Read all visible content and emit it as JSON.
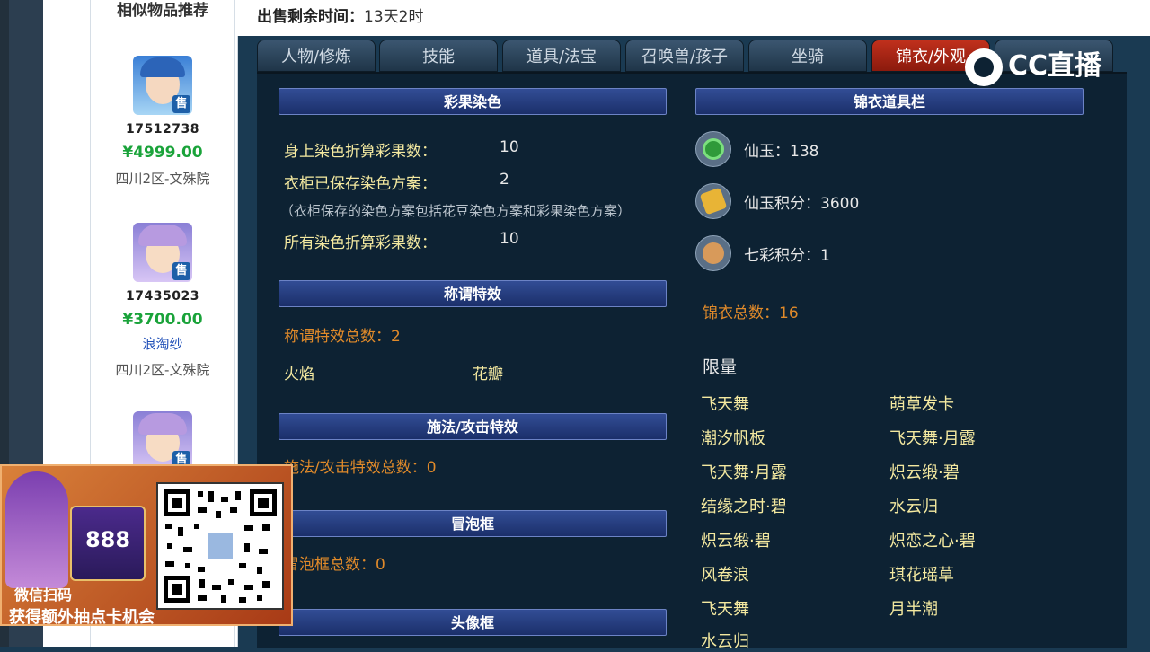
{
  "left_panel": {
    "title": "相似物品推荐",
    "items": [
      {
        "id": "17512738",
        "price": "¥4999.00",
        "extra": "",
        "server": "四川2区-文殊院",
        "sell": "售"
      },
      {
        "id": "17435023",
        "price": "¥3700.00",
        "extra": "浪淘纱",
        "server": "四川2区-文殊院",
        "sell": "售"
      },
      {
        "id": "",
        "price": "",
        "extra": "",
        "server": "",
        "sell": "售"
      }
    ]
  },
  "header": {
    "label": "出售剩余时间：",
    "value": "13天2时"
  },
  "tabs": [
    {
      "label": "人物/修炼",
      "active": false
    },
    {
      "label": "技能",
      "active": false
    },
    {
      "label": "道具/法宝",
      "active": false
    },
    {
      "label": "召唤兽/孩子",
      "active": false
    },
    {
      "label": "坐骑",
      "active": false
    },
    {
      "label": "锦衣/外观",
      "active": true
    },
    {
      "label": "",
      "active": false
    }
  ],
  "dye": {
    "header": "彩果染色",
    "rows": [
      {
        "label": "身上染色折算彩果数：",
        "value": "10"
      },
      {
        "label": "衣柜已保存染色方案：",
        "value": "2"
      },
      {
        "label": "所有染色折算彩果数：",
        "value": "10"
      }
    ],
    "note": "（衣柜保存的染色方案包括花豆染色方案和彩果染色方案）"
  },
  "title_effect": {
    "header": "称谓特效",
    "total": "称谓特效总数：2",
    "items": [
      "火焰",
      "花瓣"
    ]
  },
  "spell_effect": {
    "header": "施法/攻击特效",
    "total": "施法/攻击特效总数：0"
  },
  "bubble": {
    "header": "冒泡框",
    "total": "冒泡框总数：0"
  },
  "avatar_frame": {
    "header": "头像框"
  },
  "costume_bar": {
    "header": "锦衣道具栏",
    "currencies": [
      {
        "label": "仙玉：138",
        "icon": "jade-icon"
      },
      {
        "label": "仙玉积分：3600",
        "icon": "jade-points-icon"
      },
      {
        "label": "七彩积分：1",
        "icon": "rainbow-points-icon"
      }
    ],
    "total": "锦衣总数：16",
    "limited_label": "限量",
    "limited_items": [
      [
        "飞天舞",
        "萌草发卡"
      ],
      [
        "潮汐帆板",
        "飞天舞·月露"
      ],
      [
        "飞天舞·月露",
        "炽云缎·碧"
      ],
      [
        "结缘之时·碧",
        "水云归"
      ],
      [
        "炽云缎·碧",
        "炽恋之心·碧"
      ],
      [
        "风卷浪",
        "琪花瑶草"
      ],
      [
        "飞天舞",
        "月半潮"
      ],
      [
        "水云归",
        ""
      ]
    ]
  },
  "promo": {
    "card": "888",
    "line1": "微信扫码",
    "line2": "获得额外抽点卡机会"
  },
  "watermark": {
    "top": "CC直播",
    "main": "CC直播"
  }
}
